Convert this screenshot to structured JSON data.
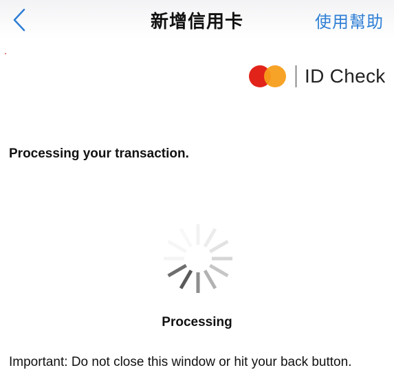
{
  "header": {
    "title": "新增信用卡",
    "help_label": "使用幫助",
    "back_icon": "chevron-left-icon",
    "accent_color": "#2f7fd4"
  },
  "brand": {
    "logo_icon": "mastercard-logo-icon",
    "logo_colors": [
      "#e2231a",
      "#f79e1b"
    ],
    "text": "ID Check"
  },
  "content": {
    "heading": "Processing your transaction.",
    "spinner_icon": "loading-spinner-icon",
    "status_label": "Processing",
    "important_note": "Important: Do not close this window or hit your back button."
  }
}
